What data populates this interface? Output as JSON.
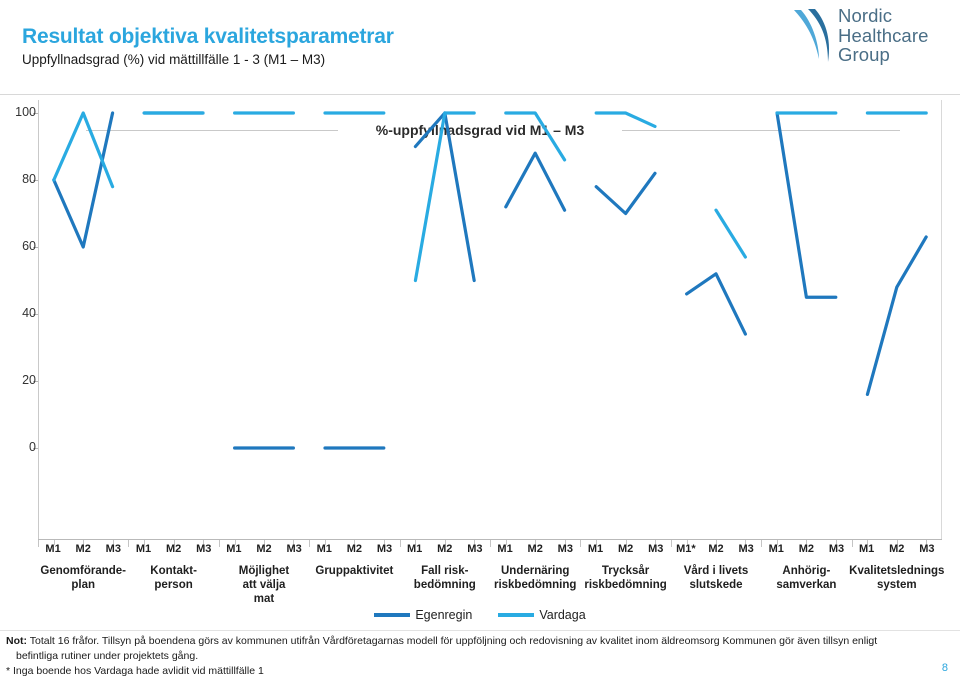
{
  "header": {
    "title": "Resultat objektiva kvalitetsparametrar",
    "subtitle": "Uppfyllnadsgrad (%) vid mättillfälle 1 - 3 (M1 – M3)",
    "logo_line1": "Nordic",
    "logo_line2": "Healthcare",
    "logo_line3": "Group"
  },
  "footer": {
    "note_line1": "Not: Totalt 16 fråfor. Tillsyn på boendena görs av kommunen utifrån Vårdföretagarnas modell för uppföljning och redovisning av kvalitet inom äldreomsorg Kommunen gör även tillsyn enligt",
    "note_line2": "befintliga rutiner under projektets gång.",
    "note_line3": "* Inga boende hos Vardaga hade avlidit vid mättillfälle 1",
    "note_label": "Not:",
    "page_number": "8"
  },
  "colors": {
    "accent": "#2BA6DE",
    "egenregin": "#1F78BE",
    "vardaga": "#29ABE2",
    "axis": "#b9b9b9"
  },
  "chart_data": {
    "type": "line",
    "title": "%-uppfyllnadsgrad vid M1 – M3",
    "xlabel": "",
    "ylabel": "",
    "ylim": [
      0,
      100
    ],
    "yticks": [
      0,
      20,
      40,
      60,
      80,
      100
    ],
    "ytick_labels": [
      "0",
      "20",
      "40",
      "60",
      "80",
      "100"
    ],
    "grid": false,
    "legend_position": "bottom",
    "measurement_points": [
      "M1",
      "M2",
      "M3"
    ],
    "categories": [
      {
        "label": "Genomförande-\nplan",
        "lines": [
          "Genomförande-",
          "plan"
        ],
        "points": [
          "M1",
          "M2",
          "M3"
        ]
      },
      {
        "label": "Kontakt-\nperson",
        "lines": [
          "Kontakt-",
          "person"
        ],
        "points": [
          "M1",
          "M2",
          "M3"
        ]
      },
      {
        "label": "Möjlighet\natt välja\nmat",
        "lines": [
          "Möjlighet",
          "att välja",
          "mat"
        ],
        "points": [
          "M1",
          "M2",
          "M3"
        ]
      },
      {
        "label": "Gruppaktivitet",
        "lines": [
          "Gruppaktivitet"
        ],
        "points": [
          "M1",
          "M2",
          "M3"
        ]
      },
      {
        "label": "Fall risk-\nbedömning",
        "lines": [
          "Fall risk-",
          "bedömning"
        ],
        "points": [
          "M1",
          "M2",
          "M3"
        ]
      },
      {
        "label": "Undernäring\nriskbedömning",
        "lines": [
          "Undernäring",
          "riskbedömning"
        ],
        "points": [
          "M1",
          "M2",
          "M3"
        ]
      },
      {
        "label": "Trycksår\nriskbedömning",
        "lines": [
          "Trycksår",
          "riskbedömning"
        ],
        "points": [
          "M1",
          "M2",
          "M3"
        ]
      },
      {
        "label": "Vård i livets\nslutskede",
        "lines": [
          "Vård i livets",
          "slutskede"
        ],
        "points": [
          "M1*",
          "M2",
          "M3"
        ]
      },
      {
        "label": "Anhörig-\nsamverkan",
        "lines": [
          "Anhörig-",
          "samverkan"
        ],
        "points": [
          "M1",
          "M2",
          "M3"
        ]
      },
      {
        "label": "Kvalitetslednings\nsystem",
        "lines": [
          "Kvalitetslednings",
          "system"
        ],
        "points": [
          "M1",
          "M2",
          "M3"
        ]
      }
    ],
    "series": [
      {
        "name": "Egenregin",
        "color": "#1F78BE",
        "values_by_category": [
          [
            80,
            60,
            100
          ],
          [
            100,
            100,
            100
          ],
          [
            0,
            0,
            0
          ],
          [
            0,
            0,
            0
          ],
          [
            90,
            100,
            50
          ],
          [
            72,
            88,
            71
          ],
          [
            78,
            70,
            82
          ],
          [
            46,
            52,
            34
          ],
          [
            100,
            45,
            45
          ],
          [
            16,
            48,
            63
          ]
        ]
      },
      {
        "name": "Vardaga",
        "color": "#29ABE2",
        "values_by_category": [
          [
            80,
            100,
            78
          ],
          [
            100,
            100,
            100
          ],
          [
            100,
            100,
            100
          ],
          [
            100,
            100,
            100
          ],
          [
            50,
            100,
            100
          ],
          [
            100,
            100,
            86
          ],
          [
            100,
            100,
            96
          ],
          [
            null,
            71,
            57
          ],
          [
            100,
            100,
            100
          ],
          [
            100,
            100,
            100
          ]
        ]
      }
    ]
  }
}
